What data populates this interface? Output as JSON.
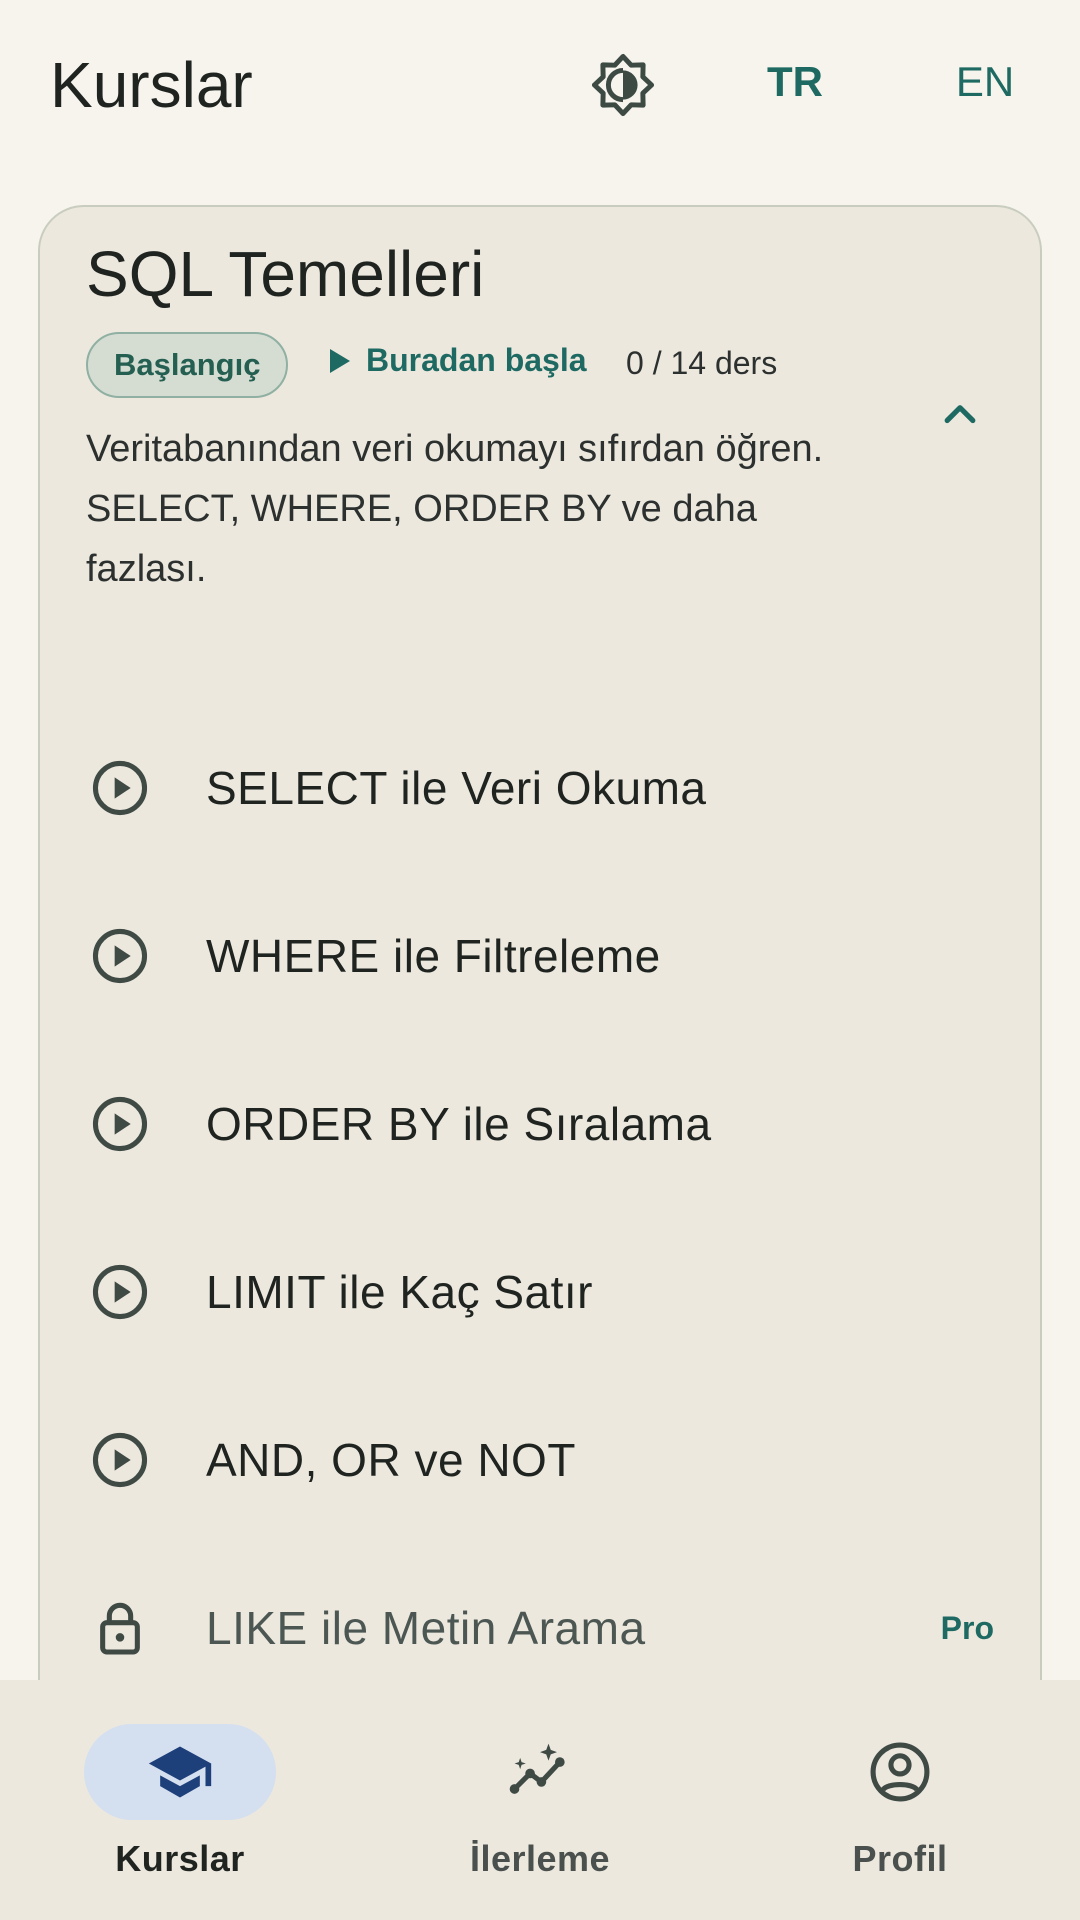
{
  "header": {
    "title": "Kurslar",
    "theme_icon": "brightness-auto-icon",
    "lang_tr": "TR",
    "lang_en": "EN"
  },
  "course": {
    "title": "SQL Temelleri",
    "level": "Başlangıç",
    "start_label": "Buradan başla",
    "lesson_count": "0 / 14 ders",
    "description": "Veritabanından veri okumayı sıfırdan öğren. SELECT, WHERE, ORDER BY ve daha fazlası.",
    "expanded": true,
    "lessons": [
      {
        "title": "SELECT ile Veri Okuma",
        "icon": "play-circle-icon",
        "locked": false
      },
      {
        "title": "WHERE ile Filtreleme",
        "icon": "play-circle-icon",
        "locked": false
      },
      {
        "title": "ORDER BY ile Sıralama",
        "icon": "play-circle-icon",
        "locked": false
      },
      {
        "title": "LIMIT ile Kaç Satır",
        "icon": "play-circle-icon",
        "locked": false
      },
      {
        "title": "AND, OR ve NOT",
        "icon": "play-circle-icon",
        "locked": false
      },
      {
        "title": "LIKE ile Metin Arama",
        "icon": "lock-icon",
        "locked": true,
        "badge": "Pro"
      }
    ]
  },
  "nav": {
    "items": [
      {
        "label": "Kurslar",
        "icon": "school-icon",
        "active": true
      },
      {
        "label": "İlerleme",
        "icon": "insights-icon",
        "active": false
      },
      {
        "label": "Profil",
        "icon": "account-circle-icon",
        "active": false
      }
    ]
  },
  "colors": {
    "background": "#f7f4ee",
    "card": "#ece8de",
    "accent": "#1e6a63",
    "nav_indicator": "#d4dff0"
  }
}
